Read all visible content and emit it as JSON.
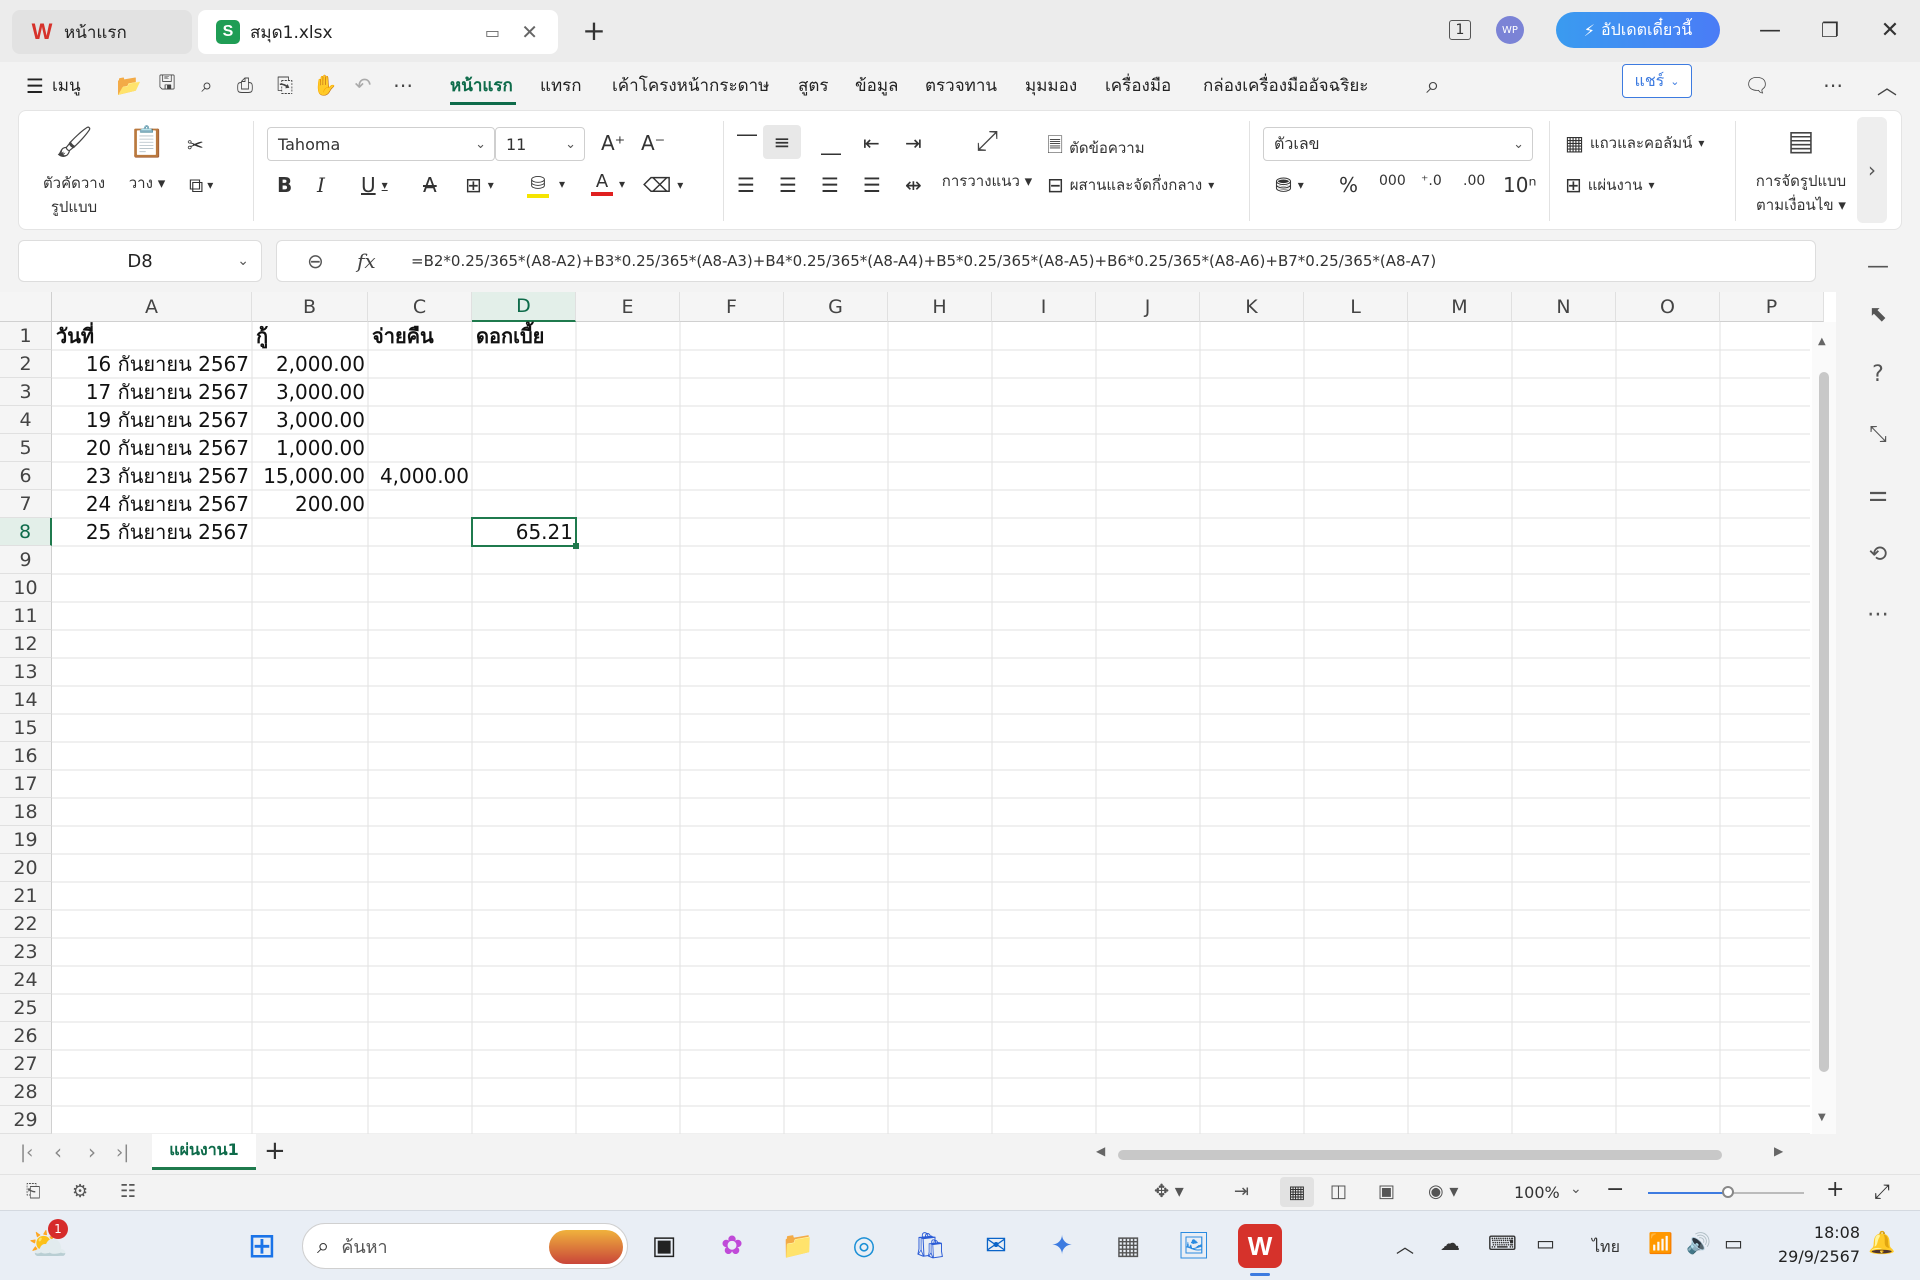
{
  "tabs": [
    {
      "label": "หน้าแรก",
      "icon": "wps-logo-icon"
    },
    {
      "label": "สมุด1.xlsx",
      "icon": "spreadsheet-icon"
    }
  ],
  "titlebar": {
    "update_label": "อัปเดตเดี๋ยวนี้",
    "avatar": "WP",
    "window_count": "1"
  },
  "menu": {
    "menu_label": "เมนู",
    "items": [
      "หน้าแรก",
      "แทรก",
      "เค้าโครงหน้ากระดาษ",
      "สูตร",
      "ข้อมูล",
      "ตรวจทาน",
      "มุมมอง",
      "เครื่องมือ",
      "กล่องเครื่องมืออัจฉริยะ"
    ],
    "share_label": "แชร์"
  },
  "ribbon": {
    "format_painter": "ตัวคัดวาง รูปแบบ",
    "format_painter_1": "ตัวคัดวาง",
    "format_painter_2": "รูปแบบ",
    "paste": "วาง",
    "font_name": "Tahoma",
    "font_size": "11",
    "wrap_text": "ตัดข้อความ",
    "orientation": "การวางแนว",
    "merge_center": "ผสานและจัดกึ่งกลาง",
    "number_format": "ตัวเลข",
    "rows_cols": "แถวและคอลัมน์",
    "worksheet": "แผ่นงาน",
    "cond_format_1": "การจัดรูปแบบ",
    "cond_format_2": "ตามเงื่อนไข",
    "font_color": "#e02020",
    "fill_color": "#f5e400"
  },
  "formula_bar": {
    "name_box": "D8",
    "fx": "fx",
    "formula": "=B2*0.25/365*(A8-A2)+B3*0.25/365*(A8-A3)+B4*0.25/365*(A8-A4)+B5*0.25/365*(A8-A5)+B6*0.25/365*(A8-A6)+B7*0.25/365*(A8-A7)"
  },
  "grid": {
    "columns": [
      "A",
      "B",
      "C",
      "D",
      "E",
      "F",
      "G",
      "H",
      "I",
      "J",
      "K",
      "L",
      "M",
      "N",
      "O",
      "P"
    ],
    "rows": [
      "1",
      "2",
      "3",
      "4",
      "5",
      "6",
      "7",
      "8",
      "9",
      "10",
      "11",
      "12",
      "13",
      "14",
      "15",
      "16",
      "17",
      "18",
      "19",
      "20",
      "21",
      "22",
      "23",
      "24",
      "25",
      "26",
      "27",
      "28",
      "29"
    ],
    "headers": {
      "A": "วันที่",
      "B": "กู้",
      "C": "จ่ายคืน",
      "D": "ดอกเบี้ย"
    },
    "data": [
      {
        "A": "16 กันยายน 2567",
        "B": "2,000.00",
        "C": "",
        "D": ""
      },
      {
        "A": "17 กันยายน 2567",
        "B": "3,000.00",
        "C": "",
        "D": ""
      },
      {
        "A": "19 กันยายน 2567",
        "B": "3,000.00",
        "C": "",
        "D": ""
      },
      {
        "A": "20 กันยายน 2567",
        "B": "1,000.00",
        "C": "",
        "D": ""
      },
      {
        "A": "23 กันยายน 2567",
        "B": "15,000.00",
        "C": "4,000.00",
        "D": ""
      },
      {
        "A": "24 กันยายน 2567",
        "B": "200.00",
        "C": "",
        "D": ""
      },
      {
        "A": "25 กันยายน 2567",
        "B": "",
        "C": "",
        "D": "65.21"
      }
    ],
    "active_cell": "D8",
    "accent_color": "#1f7a4d"
  },
  "sheet_tabs": {
    "active": "แผ่นงาน1",
    "add": "+"
  },
  "status": {
    "zoom": "100%"
  },
  "taskbar": {
    "search_placeholder": "ค้นหา",
    "language": "ไทย",
    "time": "18:08",
    "date": "29/9/2567",
    "weather_badge": "1"
  }
}
